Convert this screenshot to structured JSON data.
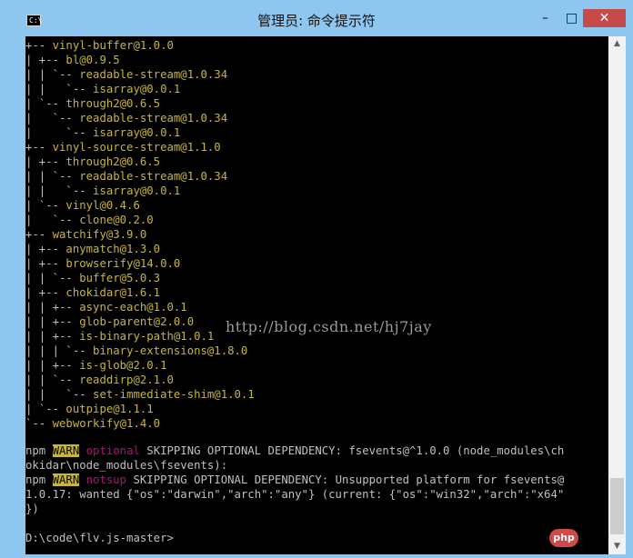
{
  "window": {
    "title": "管理员: 命令提示符",
    "icon_label": "C:\\",
    "min_glyph": "–",
    "max_glyph": "□",
    "close_glyph": "✕"
  },
  "console": {
    "lines": [
      {
        "pre": "+-- ",
        "pkg": "vinyl-buffer@1.0.0"
      },
      {
        "pre": "| +-- ",
        "pkg": "bl@0.9.5"
      },
      {
        "pre": "| | `-- ",
        "pkg": "readable-stream@1.0.34"
      },
      {
        "pre": "| |   `-- ",
        "pkg": "isarray@0.0.1"
      },
      {
        "pre": "| `-- ",
        "pkg": "through2@0.6.5"
      },
      {
        "pre": "|   `-- ",
        "pkg": "readable-stream@1.0.34"
      },
      {
        "pre": "|     `-- ",
        "pkg": "isarray@0.0.1"
      },
      {
        "pre": "+-- ",
        "pkg": "vinyl-source-stream@1.1.0"
      },
      {
        "pre": "| +-- ",
        "pkg": "through2@0.6.5"
      },
      {
        "pre": "| | `-- ",
        "pkg": "readable-stream@1.0.34"
      },
      {
        "pre": "| |   `-- ",
        "pkg": "isarray@0.0.1"
      },
      {
        "pre": "| `-- ",
        "pkg": "vinyl@0.4.6"
      },
      {
        "pre": "|   `-- ",
        "pkg": "clone@0.2.0"
      },
      {
        "pre": "+-- ",
        "pkg": "watchify@3.9.0"
      },
      {
        "pre": "| +-- ",
        "pkg": "anymatch@1.3.0"
      },
      {
        "pre": "| +-- ",
        "pkg": "browserify@14.0.0"
      },
      {
        "pre": "| | `-- ",
        "pkg": "buffer@5.0.3"
      },
      {
        "pre": "| +-- ",
        "pkg": "chokidar@1.6.1"
      },
      {
        "pre": "| | +-- ",
        "pkg": "async-each@1.0.1"
      },
      {
        "pre": "| | +-- ",
        "pkg": "glob-parent@2.0.0"
      },
      {
        "pre": "| | +-- ",
        "pkg": "is-binary-path@1.0.1"
      },
      {
        "pre": "| | | `-- ",
        "pkg": "binary-extensions@1.8.0"
      },
      {
        "pre": "| | +-- ",
        "pkg": "is-glob@2.0.1"
      },
      {
        "pre": "| | `-- ",
        "pkg": "readdirp@2.1.0"
      },
      {
        "pre": "| |   `-- ",
        "pkg": "set-immediate-shim@1.0.1"
      },
      {
        "pre": "| `-- ",
        "pkg": "outpipe@1.1.1"
      },
      {
        "pre": "`-- ",
        "pkg": "webworkify@1.4.0"
      }
    ],
    "warn1": {
      "npm": "npm ",
      "badge": "WARN",
      "tag": "optional",
      "text": " SKIPPING OPTIONAL DEPENDENCY: fsevents@^1.0.0 (node_modules\\ch",
      "cont": "okidar\\node_modules\\fsevents):"
    },
    "warn2": {
      "npm": "npm ",
      "badge": "WARN",
      "tag": "notsup",
      "text": " SKIPPING OPTIONAL DEPENDENCY: Unsupported platform for fsevents@",
      "cont1": "1.0.17: wanted {\"os\":\"darwin\",\"arch\":\"any\"} (current: {\"os\":\"win32\",\"arch\":\"x64\"",
      "cont2": "})"
    },
    "prompt": "D:\\code\\flv.js-master>",
    "watermark": "http://blog.csdn.net/hj7jay"
  },
  "scrollbar": {
    "up_glyph": "▲",
    "down_glyph": "▼"
  },
  "badge": {
    "label": "php"
  },
  "colors": {
    "title_bar": "#8fc6ef",
    "console_bg": "#000000",
    "package_text": "#c9b53a",
    "warn_badge": "#c9b53a",
    "tag_text": "#b0107a",
    "close_button": "#c74a4a"
  }
}
